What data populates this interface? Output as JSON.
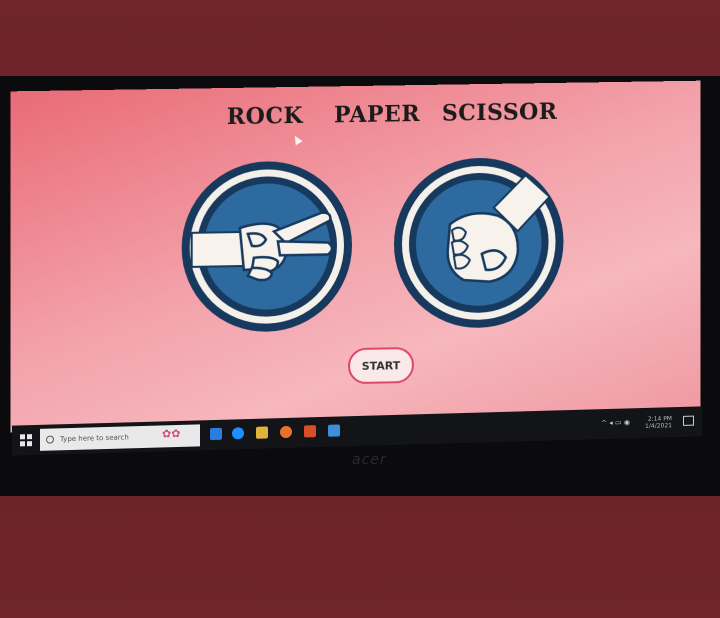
{
  "game": {
    "title_words": [
      "ROCK",
      "PAPER",
      "SCISSOR"
    ],
    "start_label": "START",
    "choices": [
      {
        "id": "scissor",
        "icon": "scissor-hand-icon"
      },
      {
        "id": "rock",
        "icon": "rock-fist-icon"
      }
    ]
  },
  "taskbar": {
    "search_placeholder": "Type here to search",
    "tray_time": "2:14 PM",
    "tray_date": "1/4/2021"
  },
  "device": {
    "brand": "acer"
  },
  "colors": {
    "background": "#6e2428",
    "screen_pink": "#f3a1aa",
    "circle_navy": "#17395e",
    "circle_blue": "#2c6aa0",
    "button_border": "#e0456a"
  }
}
